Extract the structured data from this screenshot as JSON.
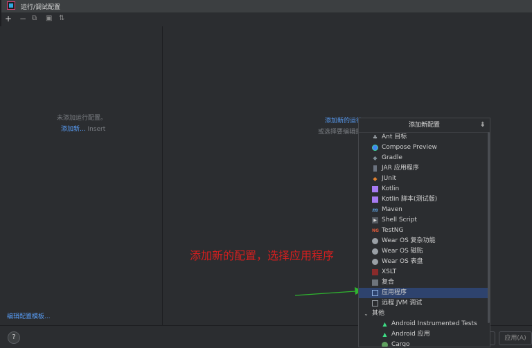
{
  "window": {
    "title": "运行/调试配置"
  },
  "toolbar": {
    "add": "+",
    "remove": "−",
    "copy": "⧉",
    "folder": "▣",
    "sort": "⇅"
  },
  "left": {
    "empty_text": "未添加运行配置。",
    "add_new_link": "添加新...",
    "insert_hint": "Insert",
    "edit_templates": "编辑配置模板..."
  },
  "right": {
    "add_link": "添加新的运行",
    "hint": "或选择要编辑的"
  },
  "popup": {
    "title": "添加新配置",
    "items": [
      {
        "label": "Ant 目标",
        "icon": "ant-icon"
      },
      {
        "label": "Compose Preview",
        "icon": "compose-icon"
      },
      {
        "label": "Gradle",
        "icon": "gradle-icon"
      },
      {
        "label": "JAR 应用程序",
        "icon": "jar-icon"
      },
      {
        "label": "JUnit",
        "icon": "junit-icon"
      },
      {
        "label": "Kotlin",
        "icon": "kotlin-icon"
      },
      {
        "label": "Kotlin 脚本(测试版)",
        "icon": "kotlin-script-icon"
      },
      {
        "label": "Maven",
        "icon": "maven-icon"
      },
      {
        "label": "Shell Script",
        "icon": "shell-icon"
      },
      {
        "label": "TestNG",
        "icon": "testng-icon"
      },
      {
        "label": "Wear OS 复杂功能",
        "icon": "wear-os-icon"
      },
      {
        "label": "Wear OS 磁贴",
        "icon": "wear-os-icon"
      },
      {
        "label": "Wear OS 表盘",
        "icon": "wear-os-icon"
      },
      {
        "label": "XSLT",
        "icon": "xslt-icon"
      },
      {
        "label": "复合",
        "icon": "compound-icon"
      },
      {
        "label": "应用程序",
        "icon": "application-icon"
      },
      {
        "label": "远程 JVM 调试",
        "icon": "remote-jvm-icon"
      },
      {
        "label": "其他",
        "icon": "chevron-down-icon"
      },
      {
        "label": "Android Instrumented Tests",
        "icon": "android-icon"
      },
      {
        "label": "Android 应用",
        "icon": "android-icon"
      },
      {
        "label": "Cargo",
        "icon": "cargo-icon"
      }
    ]
  },
  "annotation": {
    "text": "添加新的配置，选择应用程序"
  },
  "footer": {
    "help": "?",
    "apply": "应用(A)"
  },
  "colors": {
    "accent": "#589df6",
    "selection": "#2e436e",
    "annotation": "#d21f1f",
    "arrow": "#2fb52f"
  }
}
